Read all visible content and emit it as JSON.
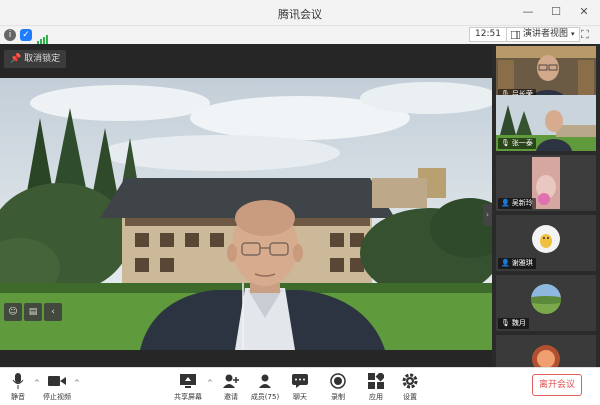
{
  "window": {
    "title": "腾讯会议"
  },
  "infobar": {
    "clock": "12:51",
    "view_label": "演讲者视图"
  },
  "stage": {
    "pin_label": "取消锁定"
  },
  "gallery": {
    "participants": [
      {
        "name": "吕长荣"
      },
      {
        "name": "张一泰"
      },
      {
        "name": "吴新玲"
      },
      {
        "name": "谢雅琪"
      },
      {
        "name": "魏月"
      }
    ]
  },
  "toolbar": {
    "mute_label": "静音",
    "video_label": "停止视频",
    "share_label": "共享屏幕",
    "invite_label": "邀请",
    "members_label": "成员(75)",
    "chat_label": "聊天",
    "record_label": "录制",
    "apps_label": "应用",
    "settings_label": "设置",
    "end_label": "离开会议"
  },
  "colors": {
    "accent": "#1e7dff",
    "end": "#e05050",
    "ok": "#2fb24c"
  }
}
